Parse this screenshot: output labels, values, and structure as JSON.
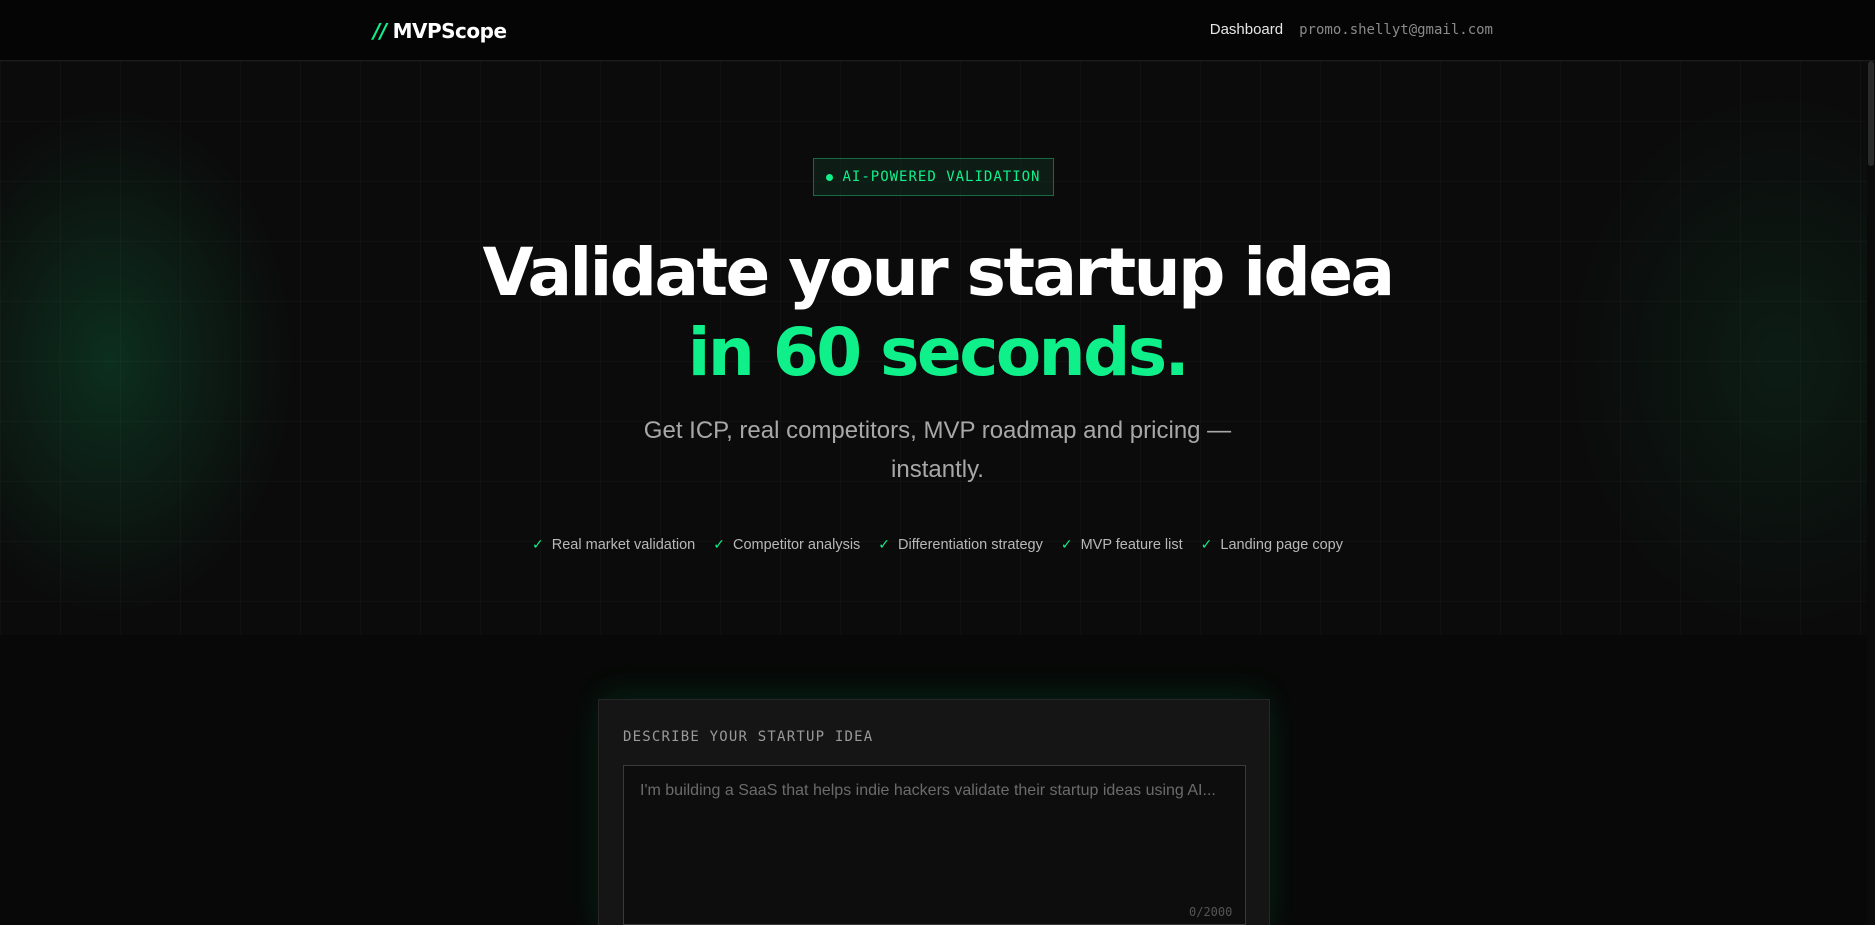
{
  "nav": {
    "logo_mark": "//",
    "logo_name": "MVPScope",
    "dashboard_label": "Dashboard",
    "user_email": "promo.shellyt@gmail.com"
  },
  "hero": {
    "badge": "AI-POWERED VALIDATION",
    "headline_line1": "Validate your startup idea",
    "headline_line2": "in 60 seconds.",
    "subtitle": "Get ICP, real competitors, MVP roadmap and pricing — instantly.",
    "features": [
      {
        "label": "Real market validation"
      },
      {
        "label": "Competitor analysis"
      },
      {
        "label": "Differentiation strategy"
      },
      {
        "label": "MVP feature list"
      },
      {
        "label": "Landing page copy"
      }
    ]
  },
  "idea_form": {
    "label": "DESCRIBE YOUR STARTUP IDEA",
    "placeholder": "I'm building a SaaS that helps indie hackers validate their startup ideas using AI...",
    "value": "",
    "char_count": "0/2000"
  },
  "colors": {
    "accent": "#10f08a",
    "background": "#0a0a0a"
  },
  "icons": {
    "check": "check-icon",
    "dot": "status-dot-icon"
  }
}
